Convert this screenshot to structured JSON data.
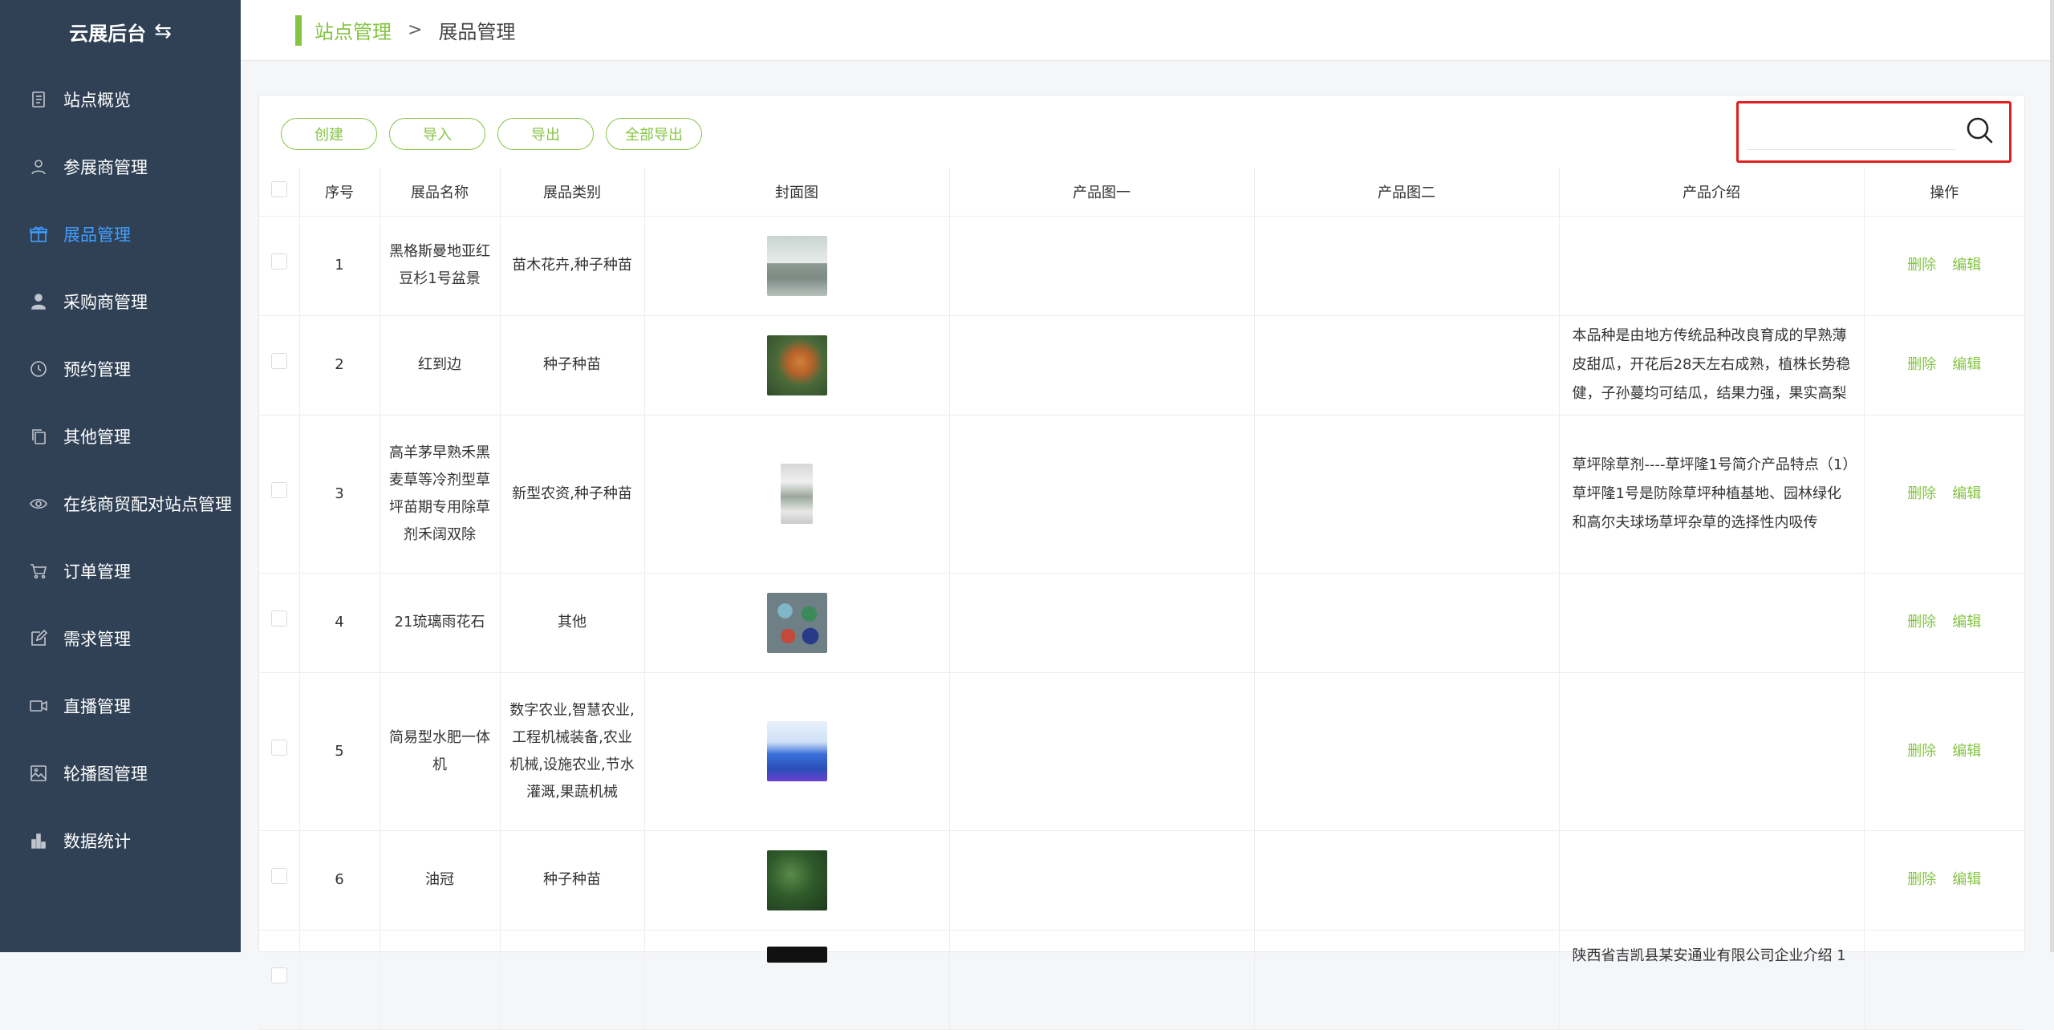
{
  "brand": {
    "title": "云展后台"
  },
  "sidebar": {
    "items": [
      {
        "label": "站点概览",
        "icon": "document-icon"
      },
      {
        "label": "参展商管理",
        "icon": "user-icon"
      },
      {
        "label": "展品管理",
        "icon": "gift-icon",
        "active": true
      },
      {
        "label": "采购商管理",
        "icon": "person-icon"
      },
      {
        "label": "预约管理",
        "icon": "clock-icon"
      },
      {
        "label": "其他管理",
        "icon": "copy-icon"
      },
      {
        "label": "在线商贸配对站点管理",
        "icon": "eye-icon"
      },
      {
        "label": "订单管理",
        "icon": "cart-icon"
      },
      {
        "label": "需求管理",
        "icon": "edit-icon"
      },
      {
        "label": "直播管理",
        "icon": "video-icon"
      },
      {
        "label": "轮播图管理",
        "icon": "image-icon"
      },
      {
        "label": "数据统计",
        "icon": "bar-chart-icon"
      }
    ]
  },
  "breadcrumb": {
    "parent": "站点管理",
    "separator": ">",
    "current": "展品管理"
  },
  "toolbar": {
    "create": "创建",
    "import": "导入",
    "export": "导出",
    "export_all": "全部导出"
  },
  "search": {
    "value": "",
    "placeholder": ""
  },
  "colors": {
    "accent": "#85c442",
    "sidebar_bg": "#304156",
    "active_menu": "#409eff",
    "highlight_border": "#e02020"
  },
  "table": {
    "headers": {
      "index": "序号",
      "name": "展品名称",
      "category": "展品类别",
      "cover": "封面图",
      "image1": "产品图一",
      "image2": "产品图二",
      "intro": "产品介绍",
      "ops": "操作"
    },
    "actions": {
      "delete": "删除",
      "edit": "编辑"
    },
    "rows": [
      {
        "index": "1",
        "name": "黑格斯曼地亚红豆杉1号盆景",
        "category": "苗木花卉,种子种苗",
        "intro": ""
      },
      {
        "index": "2",
        "name": "红到边",
        "category": "种子种苗",
        "intro": "本品种是由地方传统品种改良育成的早熟薄皮甜瓜，开花后28天左右成熟，植株长势稳健，子孙蔓均可结瓜，结果力强，果实高梨"
      },
      {
        "index": "3",
        "name": "高羊茅早熟禾黑麦草等冷剂型草坪苗期专用除草剂禾阔双除",
        "category": "新型农资,种子种苗",
        "intro": "草坪除草剂----草坪隆1号简介产品特点（1）草坪隆1号是防除草坪种植基地、园林绿化和高尔夫球场草坪杂草的选择性内吸传"
      },
      {
        "index": "4",
        "name": "21琉璃雨花石",
        "category": "其他",
        "intro": ""
      },
      {
        "index": "5",
        "name": "简易型水肥一体机",
        "category": "数字农业,智慧农业,工程机械装备,农业机械,设施农业,节水灌溉,果蔬机械",
        "intro": ""
      },
      {
        "index": "6",
        "name": "油冠",
        "category": "种子种苗",
        "intro": ""
      },
      {
        "index": "",
        "name": "",
        "category": "",
        "intro": "陕西省吉凯县某安通业有限公司企业介绍 1"
      }
    ]
  }
}
